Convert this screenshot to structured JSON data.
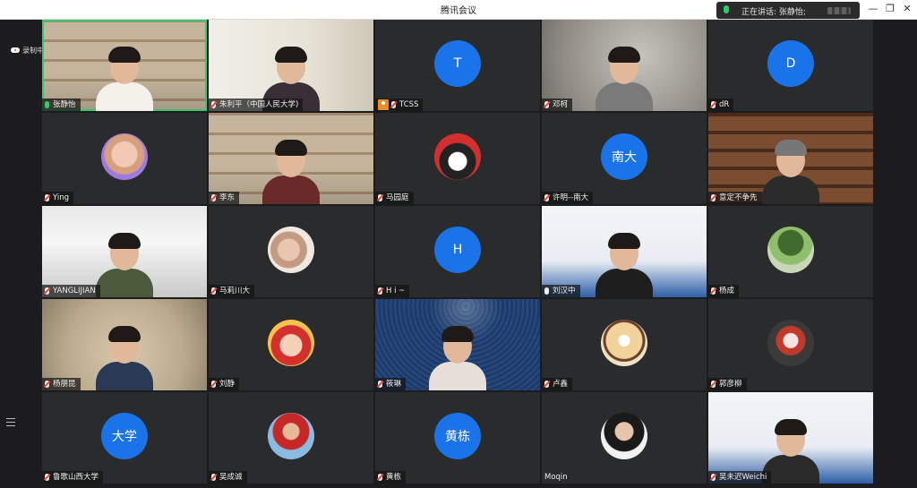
{
  "window": {
    "title": "腾讯会议"
  },
  "speaker": {
    "text": "正在讲话: 张静怡;"
  },
  "recording": {
    "label": "录制中"
  },
  "colors": {
    "accent": "#1a73e8",
    "active_border": "#3ec46d"
  },
  "participants": [
    {
      "name": "张静怡",
      "mic": "on",
      "kind": "video"
    },
    {
      "name": "朱利平（中国人民大学)",
      "mic": "off",
      "kind": "video"
    },
    {
      "name": "TCSS",
      "mic": "off",
      "kind": "letter",
      "letter": "T",
      "host": true
    },
    {
      "name": "邓柯",
      "mic": "off",
      "kind": "video"
    },
    {
      "name": "dR",
      "mic": "off",
      "kind": "letter",
      "letter": "D"
    },
    {
      "name": "Ying",
      "mic": "off",
      "kind": "picture"
    },
    {
      "name": "李东",
      "mic": "off",
      "kind": "video"
    },
    {
      "name": "马园庭",
      "mic": "off",
      "kind": "picture"
    },
    {
      "name": "许明--南大",
      "mic": "off",
      "kind": "letter",
      "letter": "南大"
    },
    {
      "name": "意定不争先",
      "mic": "off",
      "kind": "video"
    },
    {
      "name": "YANGLIJIAN",
      "mic": "off",
      "kind": "video"
    },
    {
      "name": "马莉川大",
      "mic": "off",
      "kind": "picture"
    },
    {
      "name": "H i ~",
      "mic": "off",
      "kind": "letter",
      "letter": "H"
    },
    {
      "name": "刘汉中",
      "mic": "idle",
      "kind": "video"
    },
    {
      "name": "杨成",
      "mic": "off",
      "kind": "picture"
    },
    {
      "name": "杨朋昆",
      "mic": "off",
      "kind": "video"
    },
    {
      "name": "刘静",
      "mic": "off",
      "kind": "picture"
    },
    {
      "name": "筱琳",
      "mic": "off",
      "kind": "video"
    },
    {
      "name": "卢鑫",
      "mic": "off",
      "kind": "picture"
    },
    {
      "name": "郭彦柳",
      "mic": "off",
      "kind": "picture"
    },
    {
      "name": "鲁歌山西大学",
      "mic": "off",
      "kind": "letter",
      "letter": "大学"
    },
    {
      "name": "吴成诚",
      "mic": "off",
      "kind": "picture"
    },
    {
      "name": "黄栋",
      "mic": "off",
      "kind": "letter",
      "letter": "黄栋"
    },
    {
      "name": "Moqin",
      "mic": "none",
      "kind": "picture"
    },
    {
      "name": "吴未迟Weichi",
      "mic": "off",
      "kind": "video"
    }
  ]
}
